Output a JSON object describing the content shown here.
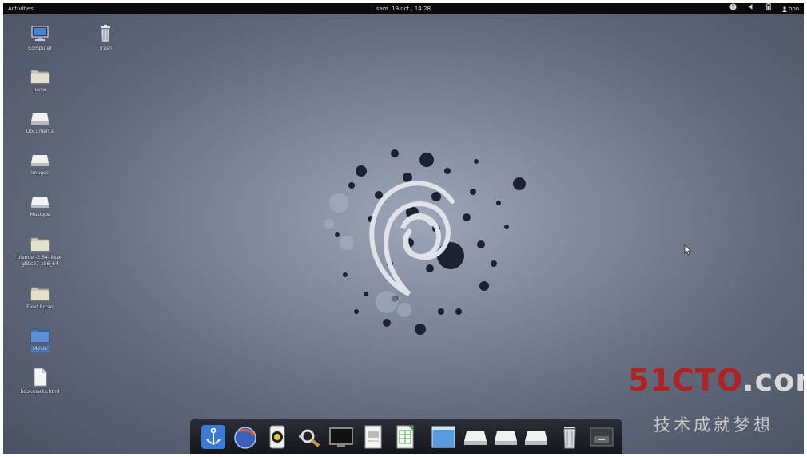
{
  "topbar": {
    "activities": "Activities",
    "clock": "sam. 19 oct., 14:28",
    "user": "hpo"
  },
  "desktop_icons": [
    {
      "label": "Computer",
      "icon": "computer-icon"
    },
    {
      "label": "home",
      "icon": "folder-icon"
    },
    {
      "label": "Documents",
      "icon": "folder-open-icon"
    },
    {
      "label": "Images",
      "icon": "folder-open-icon"
    },
    {
      "label": "Musique",
      "icon": "folder-open-icon"
    },
    {
      "label": "blender-2.64-linux-glibc27-x86_64",
      "icon": "folder-icon"
    },
    {
      "label": "Fond Ecran",
      "icon": "folder-icon"
    },
    {
      "label": "Movie",
      "icon": "folder-blue-icon"
    },
    {
      "label": "bookmarks.html",
      "icon": "file-icon"
    },
    {
      "label": "Trash",
      "icon": "trash-icon"
    }
  ],
  "dock_items": [
    "anchor-app-icon",
    "browser-globe-icon",
    "media-player-icon",
    "search-tool-icon",
    "display-icon",
    "document-viewer-icon",
    "spreadsheet-icon",
    "window-icon",
    "drive-icon",
    "drive-icon",
    "drive-icon",
    "trash-icon",
    "printer-icon"
  ],
  "watermark": {
    "brand": "51CTO",
    "suffix": ".com",
    "slogan": "技术成就梦想"
  },
  "colors": {
    "watermark_red": "#b22222",
    "selection_blue": "#4a7fc4"
  }
}
